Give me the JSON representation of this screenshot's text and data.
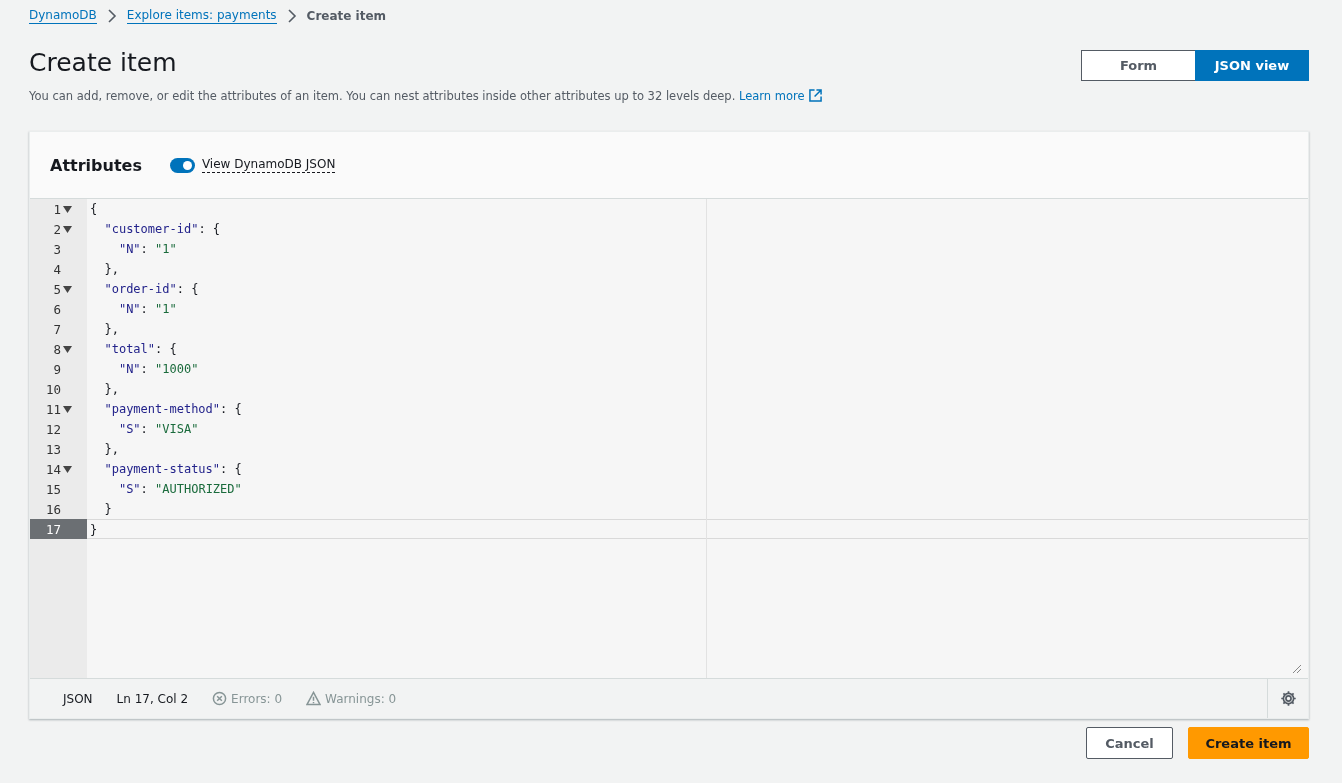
{
  "breadcrumbs": [
    {
      "label": "DynamoDB",
      "link": true
    },
    {
      "label": "Explore items: payments",
      "link": true
    },
    {
      "label": "Create item",
      "link": false
    }
  ],
  "page": {
    "title": "Create item",
    "description": "You can add, remove, or edit the attributes of an item. You can nest attributes inside other attributes up to 32 levels deep.",
    "learn_more": "Learn more"
  },
  "view_toggle": [
    {
      "label": "Form",
      "selected": false
    },
    {
      "label": "JSON view",
      "selected": true
    }
  ],
  "attributes": {
    "title": "Attributes",
    "dynamodb_json_toggle": {
      "label": "View DynamoDB JSON",
      "on": true
    }
  },
  "editor": {
    "lines": [
      {
        "number": "1",
        "foldable": true,
        "current": false,
        "text": "{"
      },
      {
        "number": "2",
        "foldable": true,
        "current": false,
        "text": "  \"customer-id\": {"
      },
      {
        "number": "3",
        "foldable": false,
        "current": false,
        "text": "    \"N\": \"1\""
      },
      {
        "number": "4",
        "foldable": false,
        "current": false,
        "text": "  },"
      },
      {
        "number": "5",
        "foldable": true,
        "current": false,
        "text": "  \"order-id\": {"
      },
      {
        "number": "6",
        "foldable": false,
        "current": false,
        "text": "    \"N\": \"1\""
      },
      {
        "number": "7",
        "foldable": false,
        "current": false,
        "text": "  },"
      },
      {
        "number": "8",
        "foldable": true,
        "current": false,
        "text": "  \"total\": {"
      },
      {
        "number": "9",
        "foldable": false,
        "current": false,
        "text": "    \"N\": \"1000\""
      },
      {
        "number": "10",
        "foldable": false,
        "current": false,
        "text": "  },"
      },
      {
        "number": "11",
        "foldable": true,
        "current": false,
        "text": "  \"payment-method\": {"
      },
      {
        "number": "12",
        "foldable": false,
        "current": false,
        "text": "    \"S\": \"VISA\""
      },
      {
        "number": "13",
        "foldable": false,
        "current": false,
        "text": "  },"
      },
      {
        "number": "14",
        "foldable": true,
        "current": false,
        "text": "  \"payment-status\": {"
      },
      {
        "number": "15",
        "foldable": false,
        "current": false,
        "text": "    \"S\": \"AUTHORIZED\""
      },
      {
        "number": "16",
        "foldable": false,
        "current": false,
        "text": "  }"
      },
      {
        "number": "17",
        "foldable": false,
        "current": true,
        "text": "}"
      }
    ],
    "status_bar": {
      "language": "JSON",
      "position": "Ln 17, Col 2",
      "errors": "Errors: 0",
      "warnings": "Warnings: 0"
    }
  },
  "buttons": [
    {
      "label": "Cancel",
      "kind": "secondary"
    },
    {
      "label": "Create item",
      "kind": "primary"
    }
  ]
}
